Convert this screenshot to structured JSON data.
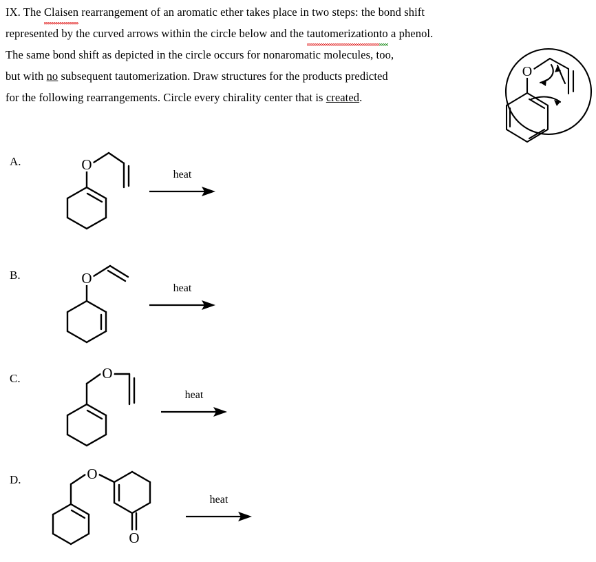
{
  "document": {
    "problem_number": "IX.",
    "paragraph_lines": [
      {
        "segments": [
          {
            "text": "IX.  The ",
            "style": "plain"
          },
          {
            "text": "Claisen",
            "style": "squiggle-red"
          },
          {
            "text": " rearrangement of an aromatic ether takes place in two steps: the bond shift",
            "style": "plain"
          }
        ]
      },
      {
        "segments": [
          {
            "text": "represented by the curved arrows within the circle below and the ",
            "style": "plain"
          },
          {
            "text": "tautomerization",
            "style": "squiggle-red"
          },
          {
            "text": " to",
            "style": "squiggle-green"
          },
          {
            "text": " a phenol.",
            "style": "plain"
          }
        ]
      },
      {
        "segments": [
          {
            "text": "The same bond shift as depicted in the circle occurs for nonaromatic molecules, too,",
            "style": "plain"
          }
        ]
      },
      {
        "segments": [
          {
            "text": "but with ",
            "style": "plain"
          },
          {
            "text": "no",
            "style": "underline"
          },
          {
            "text": " subsequent tautomerization. Draw structures for the products predicted",
            "style": "plain"
          }
        ]
      },
      {
        "segments": [
          {
            "text": "for the following rearrangements.  Circle every chirality center that is ",
            "style": "plain"
          },
          {
            "text": "created",
            "style": "underline"
          },
          {
            "text": ".",
            "style": "plain"
          }
        ]
      }
    ]
  },
  "mechanism": {
    "name": "claisen-rearrangement-mechanism",
    "description": "allyl phenyl ether with three curved electron-pushing arrows enclosed in a circle",
    "atom_labels": [
      "O"
    ],
    "oxygen_label": "O",
    "arrow_count": 3,
    "circle_color": "#000000",
    "oxygen_color": "#000000"
  },
  "problems": [
    {
      "label": "A.",
      "reagent_label": "heat",
      "structure_name": "cyclohex-1-en-1-yl allyl ether",
      "substrate": {
        "ring": "cyclohexene",
        "ring_double_bond": "C1=C2",
        "substituent": "O-CH2-CH=CH2",
        "oxygen_label": "O",
        "attached_at": "sp2 ring carbon C1"
      }
    },
    {
      "label": "B.",
      "reagent_label": "heat",
      "structure_name": "cyclohex-2-en-1-yl vinyl ether",
      "substrate": {
        "ring": "cyclohexene",
        "ring_double_bond": "C2=C3",
        "substituent": "O-CH=CH2",
        "oxygen_label": "O",
        "attached_at": "sp3 ring carbon C1"
      }
    },
    {
      "label": "C.",
      "reagent_label": "heat",
      "structure_name": "(cyclohex-1-en-1-yl)methyl vinyl ether",
      "substrate": {
        "ring": "cyclohexene",
        "ring_double_bond": "C1=C2",
        "substituent": "CH2-O-CH=CH2",
        "oxygen_label": "O",
        "attached_at": "sp2 ring carbon C1"
      }
    },
    {
      "label": "D.",
      "reagent_label": "heat",
      "structure_name": "3-[(cyclohex-1-en-1-yl)methoxy]cyclohex-2-en-1-one",
      "substrate": {
        "ring": "cyclohexene",
        "ring_double_bond": "C1=C2",
        "substituent": "CH2-O-(cyclohexenone C3)",
        "oxygen_label": "O",
        "second_ring": "cyclohex-2-en-1-one",
        "ketone_label": "O",
        "attached_at": "sp2 ring carbon C1"
      }
    }
  ],
  "colors": {
    "ink": "#000000",
    "spellcheck_red": "#e01b1b",
    "grammar_green": "#1b8a1b",
    "page_background": "#ffffff"
  }
}
